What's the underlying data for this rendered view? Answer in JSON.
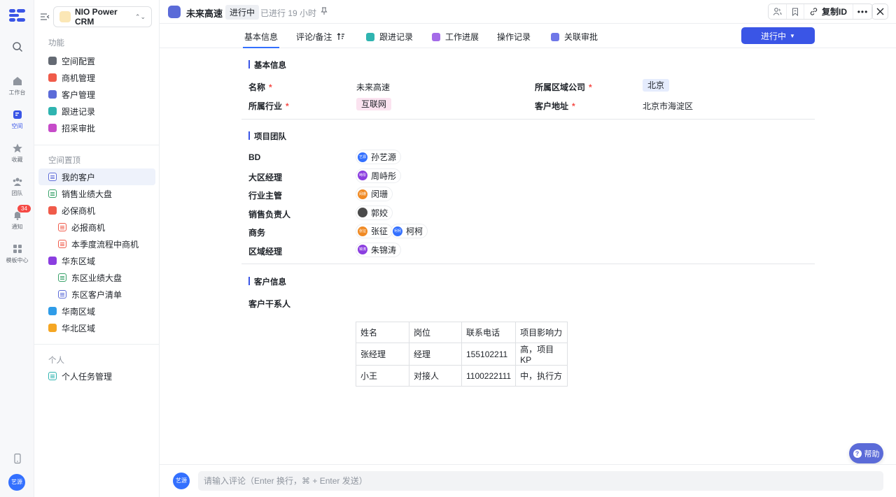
{
  "rail": {
    "items": [
      {
        "label": "工作台"
      },
      {
        "label": "空间"
      },
      {
        "label": "收藏"
      },
      {
        "label": "团队"
      },
      {
        "label": "通知",
        "badge": "34"
      },
      {
        "label": "模板中心"
      }
    ],
    "avatar": "艺源"
  },
  "workspace": {
    "name": "NIO Power CRM"
  },
  "sidebar": {
    "sections": [
      "功能",
      "空间置顶",
      "个人"
    ],
    "function_items": [
      "空间配置",
      "商机管理",
      "客户管理",
      "跟进记录",
      "招采审批"
    ],
    "pinned_items": [
      "我的客户",
      "销售业绩大盘",
      "必保商机",
      "必报商机",
      "本季度流程中商机",
      "华东区域",
      "东区业绩大盘",
      "东区客户清单",
      "华南区域",
      "华北区域"
    ],
    "personal_items": [
      "个人任务管理"
    ]
  },
  "header": {
    "title": "未来高速",
    "status": "进行中",
    "elapsed": "已进行 19 小时",
    "copy_id": "复制ID"
  },
  "tabs": [
    "基本信息",
    "评论/备注",
    "跟进记录",
    "工作进展",
    "操作记录",
    "关联审批"
  ],
  "progress_button": "进行中",
  "basic": {
    "section": "基本信息",
    "name_label": "名称",
    "name_value": "未来高速",
    "region_label": "所属区域公司",
    "region_value": "北京",
    "industry_label": "所属行业",
    "industry_value": "互联网",
    "address_label": "客户地址",
    "address_value": "北京市海淀区"
  },
  "team": {
    "section": "项目团队",
    "roles": [
      {
        "role": "BD",
        "people": [
          {
            "name": "孙艺源",
            "initials": "艺源",
            "color": "#3370ff"
          }
        ]
      },
      {
        "role": "大区经理",
        "people": [
          {
            "name": "周峙彤",
            "initials": "峙彤",
            "color": "#8b3ee0"
          }
        ]
      },
      {
        "role": "行业主管",
        "people": [
          {
            "name": "闵珊",
            "initials": "闵珊",
            "color": "#f08a24"
          }
        ]
      },
      {
        "role": "销售负责人",
        "people": [
          {
            "name": "郭姣",
            "initials": "",
            "color": "#4a4a4a"
          }
        ]
      },
      {
        "role": "商务",
        "people": [
          {
            "name": "张征",
            "initials": "张征",
            "color": "#f08a24"
          },
          {
            "name": "柯柯",
            "initials": "柯柯",
            "color": "#3370ff"
          }
        ]
      },
      {
        "role": "区域经理",
        "people": [
          {
            "name": "朱锦涛",
            "initials": "锦涛",
            "color": "#8b3ee0"
          }
        ]
      }
    ]
  },
  "customer": {
    "section": "客户信息",
    "contacts_label": "客户干系人",
    "table": {
      "headers": [
        "姓名",
        "岗位",
        "联系电话",
        "项目影响力"
      ],
      "rows": [
        [
          "张经理",
          "经理",
          "155102211",
          "高，项目KP"
        ],
        [
          "小王",
          "对接人",
          "1100222111",
          "中，执行方"
        ]
      ]
    }
  },
  "comment": {
    "avatar": "艺源",
    "placeholder": "请输入评论（Enter 换行，⌘ + Enter 发送）"
  },
  "help": "帮助"
}
